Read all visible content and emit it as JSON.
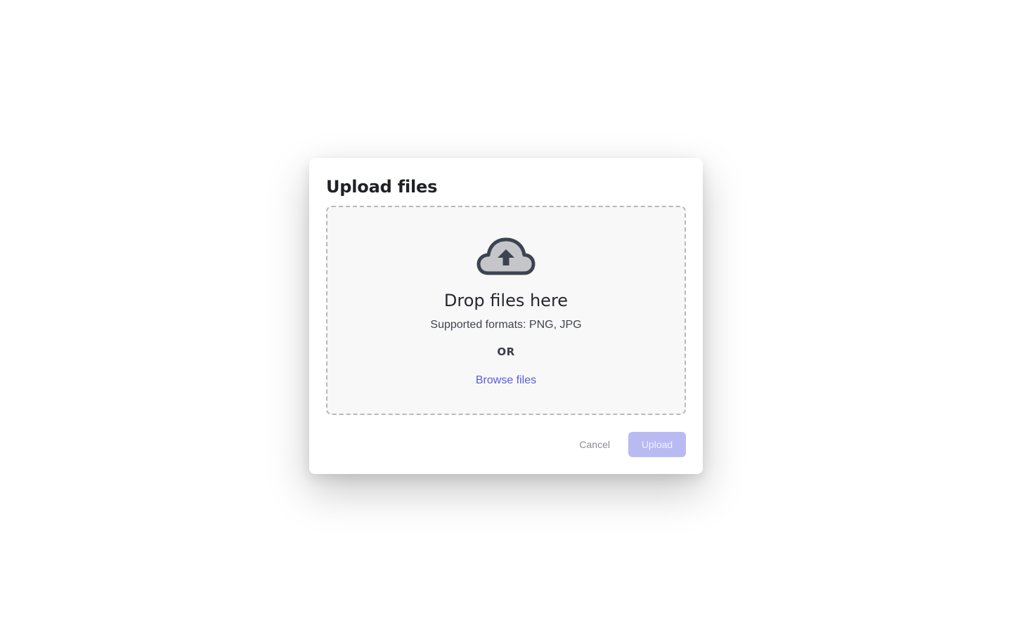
{
  "dialog": {
    "title": "Upload files"
  },
  "dropzone": {
    "icon": "cloud-upload-icon",
    "heading": "Drop files here",
    "formats": "Supported formats: PNG, JPG",
    "divider": "OR",
    "browse_label": "Browse files"
  },
  "footer": {
    "cancel_label": "Cancel",
    "upload_label": "Upload",
    "upload_disabled": true
  },
  "colors": {
    "accent": "#5b5bd6",
    "accent_disabled": "#babaf3",
    "icon": "#3d4350",
    "icon_fill": "#c5c6c9"
  }
}
